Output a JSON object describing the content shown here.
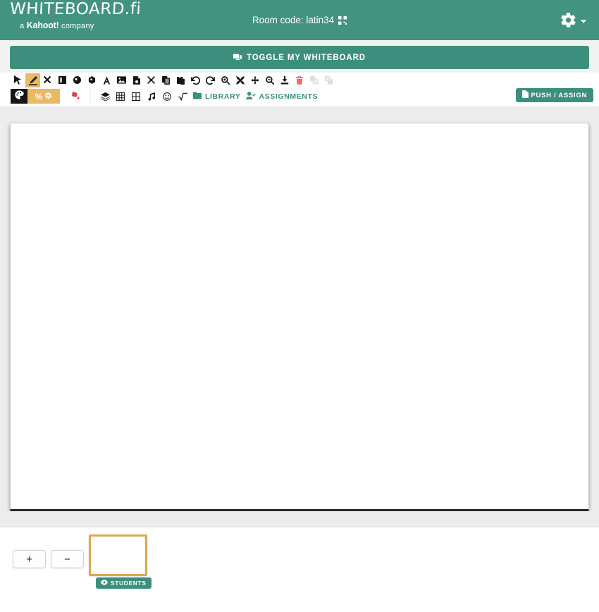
{
  "header": {
    "brand_title": "WHITEBOARD.fi",
    "brand_sub_prefix": "a ",
    "brand_sub_kahoot": "Kahoot!",
    "brand_sub_suffix": " company",
    "room_code_label": "Room code: latin34",
    "qr_icon": "qr-code-icon",
    "gear_icon": "gear-icon",
    "caret_icon": "chevron-down-icon",
    "accent_color": "#429481"
  },
  "toggle_bar": {
    "label": "TOGGLE MY WHITEBOARD",
    "icon": "toggle-whiteboard-icon"
  },
  "toolbar": {
    "row1": [
      {
        "name": "select-tool",
        "title": "Select",
        "active": false,
        "disabled": false
      },
      {
        "name": "pencil-tool",
        "title": "Pen",
        "active": true,
        "disabled": false
      },
      {
        "name": "eraser-tool",
        "title": "Eraser",
        "active": false,
        "disabled": false
      },
      {
        "name": "rectangle-tool",
        "title": "Rectangle",
        "active": false,
        "disabled": false
      },
      {
        "name": "circle-tool",
        "title": "Circle",
        "active": false,
        "disabled": false
      },
      {
        "name": "polygon-tool",
        "title": "Polygon",
        "active": false,
        "disabled": false
      },
      {
        "name": "text-tool",
        "title": "Text",
        "active": false,
        "disabled": false
      },
      {
        "name": "image-tool",
        "title": "Image",
        "active": false,
        "disabled": false
      },
      {
        "name": "sticky-note-tool",
        "title": "Note",
        "active": false,
        "disabled": false
      },
      {
        "name": "close-tool",
        "title": "Clear",
        "active": false,
        "disabled": false
      },
      {
        "name": "copy-tool",
        "title": "Copy",
        "active": false,
        "disabled": false
      },
      {
        "name": "paste-tool",
        "title": "Paste",
        "active": false,
        "disabled": false
      },
      {
        "name": "undo-tool",
        "title": "Undo",
        "active": false,
        "disabled": false
      },
      {
        "name": "redo-tool",
        "title": "Redo",
        "active": false,
        "disabled": false
      },
      {
        "name": "zoom-in-tool",
        "title": "Zoom in",
        "active": false,
        "disabled": false
      },
      {
        "name": "fit-screen-tool",
        "title": "Fit",
        "active": false,
        "disabled": false
      },
      {
        "name": "pan-tool",
        "title": "Pan",
        "active": false,
        "disabled": false
      },
      {
        "name": "zoom-out-tool",
        "title": "Zoom out",
        "active": false,
        "disabled": false
      },
      {
        "name": "download-tool",
        "title": "Download",
        "active": false,
        "disabled": false
      },
      {
        "name": "delete-tool",
        "title": "Delete",
        "active": false,
        "disabled": false
      },
      {
        "name": "bring-forward-tool",
        "title": "Bring forward",
        "active": false,
        "disabled": true
      },
      {
        "name": "send-backward-tool",
        "title": "Send backward",
        "active": false,
        "disabled": true
      }
    ],
    "row2_icons": [
      {
        "name": "layers-tool",
        "title": "Layers"
      },
      {
        "name": "grid-tool",
        "title": "Grid"
      },
      {
        "name": "table-tool",
        "title": "Table"
      },
      {
        "name": "music-tool",
        "title": "Music"
      },
      {
        "name": "emoji-tool",
        "title": "Emoji"
      },
      {
        "name": "math-tool",
        "title": "Math"
      }
    ],
    "palette_icon": "color-palette-icon",
    "stroke_size_label": "%",
    "stroke_gear_icon": "gear-icon",
    "fill_icon": "fill-bucket-icon",
    "library_label": "LIBRARY",
    "library_icon": "library-icon",
    "assignments_label": "ASSIGNMENTS",
    "assignments_icon": "assignments-icon",
    "push_assign_label": "PUSH / ASSIGN",
    "push_assign_icon": "push-assign-icon",
    "active_color": "#e9b963",
    "link_color": "#3d8f7d"
  },
  "footer": {
    "add_page_label": "+",
    "remove_page_label": "−",
    "students_badge_label": "STUDENTS",
    "students_badge_icon": "eye-icon",
    "page_thumb_border_color": "#dba94e"
  }
}
